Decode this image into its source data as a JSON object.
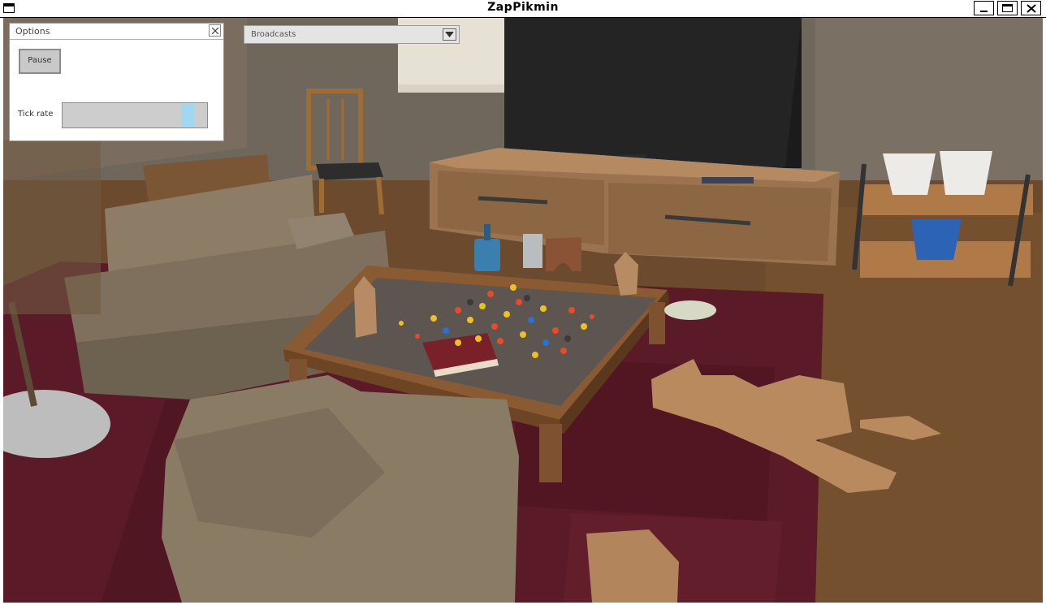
{
  "window": {
    "title": "ZapPikmin"
  },
  "options_panel": {
    "title": "Options",
    "pause_label": "Pause",
    "tick_rate_label": "Tick rate",
    "tick_rate_value": 0.9
  },
  "broadcasts": {
    "selected": "Broadcasts"
  },
  "icons": {
    "window_menu": "window-menu-icon",
    "minimize": "minimize-icon",
    "maximize": "maximize-icon",
    "close": "close-icon",
    "panel_close": "close-icon",
    "dropdown": "chevron-down-icon"
  },
  "colors": {
    "slider_thumb": "#9ed8f3",
    "rug": "#5a1b27",
    "floor": "#6e4a2c",
    "wall": "#6e655b"
  }
}
